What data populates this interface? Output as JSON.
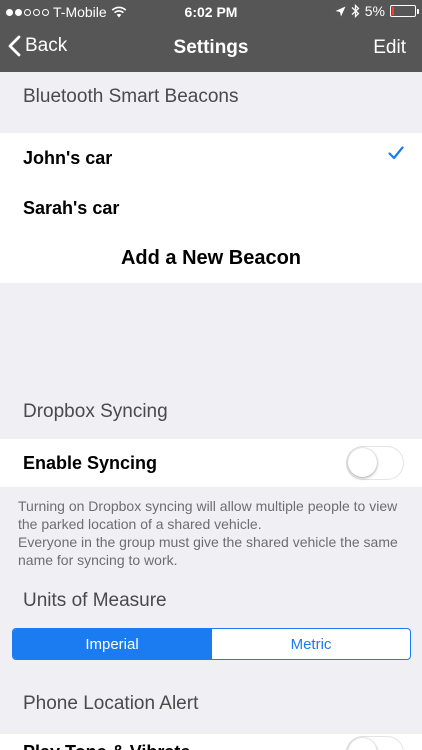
{
  "status_bar": {
    "carrier": "T-Mobile",
    "time": "6:02 PM",
    "battery": "5%",
    "battery_level": 0.05
  },
  "nav": {
    "back_label": "Back",
    "title": "Settings",
    "edit_label": "Edit"
  },
  "beacons": {
    "header": "Bluetooth Smart Beacons",
    "items": [
      {
        "label": "John's car",
        "checked": true
      },
      {
        "label": "Sarah's car",
        "checked": false
      }
    ],
    "add_label": "Add a New Beacon"
  },
  "dropbox": {
    "header": "Dropbox Syncing",
    "enable_label": "Enable Syncing",
    "enabled": false,
    "footnote_1": "Turning on Dropbox syncing will allow multiple people to view the parked location of a shared vehicle.",
    "footnote_2": "Everyone in the group must give the shared vehicle the same name for syncing to work."
  },
  "units": {
    "header": "Units of Measure",
    "options": [
      "Imperial",
      "Metric"
    ],
    "selected": "Imperial"
  },
  "alert": {
    "header": "Phone Location Alert",
    "partial_row_label": "Play Tone & Vibrate"
  },
  "colors": {
    "accent": "#1b7cf2",
    "bar": "#565656",
    "background": "#efeff4",
    "battery_low": "#ff3b30"
  }
}
